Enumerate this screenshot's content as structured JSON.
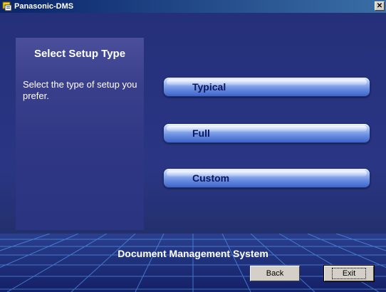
{
  "window": {
    "title": "Panasonic-DMS",
    "close_label": "✕"
  },
  "panel": {
    "title": "Select Setup Type",
    "description": "Select the type of setup you prefer."
  },
  "options": [
    {
      "label": "Typical"
    },
    {
      "label": "Full"
    },
    {
      "label": "Custom"
    }
  ],
  "footer": {
    "title": "Document Management System",
    "back_label": "Back",
    "exit_label": "Exit"
  }
}
